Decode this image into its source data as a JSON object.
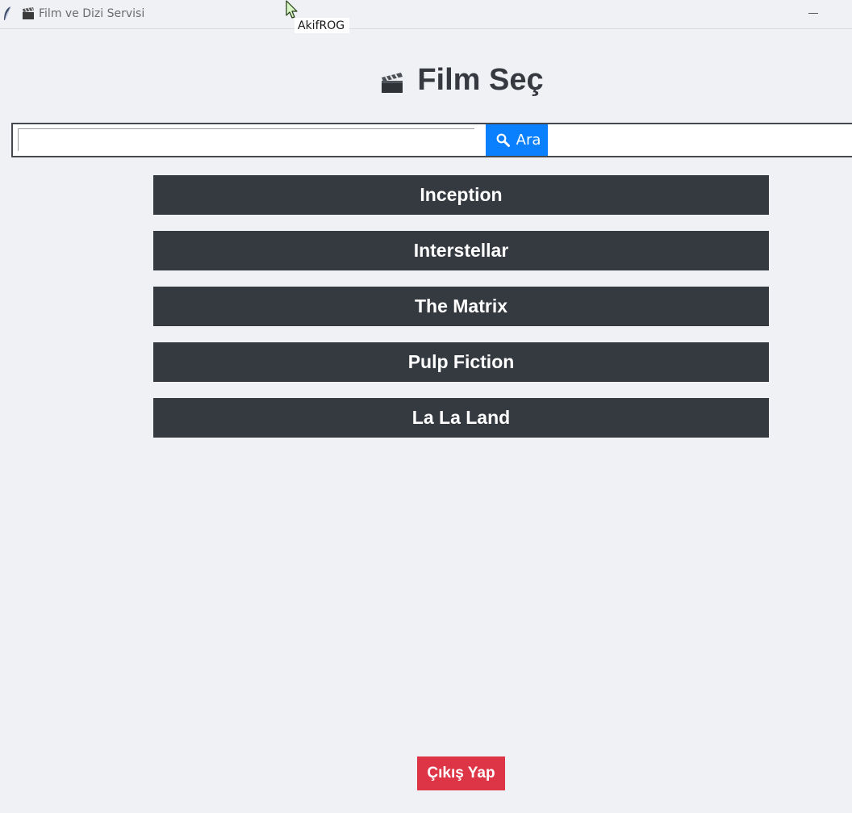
{
  "window": {
    "title": "Film ve Dizi Servisi",
    "app_icon": "feather-icon",
    "title_icon": "clapper-board-icon",
    "minimize_icon": "minimize-icon"
  },
  "cursor": {
    "icon": "mouse-pointer-icon",
    "tooltip": "AkifROG"
  },
  "header": {
    "icon": "clapper-board-icon",
    "title": "Film Seç"
  },
  "search": {
    "value": "",
    "button_icon": "magnifier-icon",
    "button_label": "Ara"
  },
  "movies": [
    {
      "label": "Inception"
    },
    {
      "label": "Interstellar"
    },
    {
      "label": "The Matrix"
    },
    {
      "label": "Pulp Fiction"
    },
    {
      "label": "La La Land"
    }
  ],
  "footer": {
    "exit_label": "Çıkış Yap"
  },
  "colors": {
    "background": "#f0f1f5",
    "movie_button_bg": "#353a41",
    "search_button_bg": "#0a80fe",
    "exit_button_bg": "#dd3446",
    "title_text": "#363a40"
  }
}
